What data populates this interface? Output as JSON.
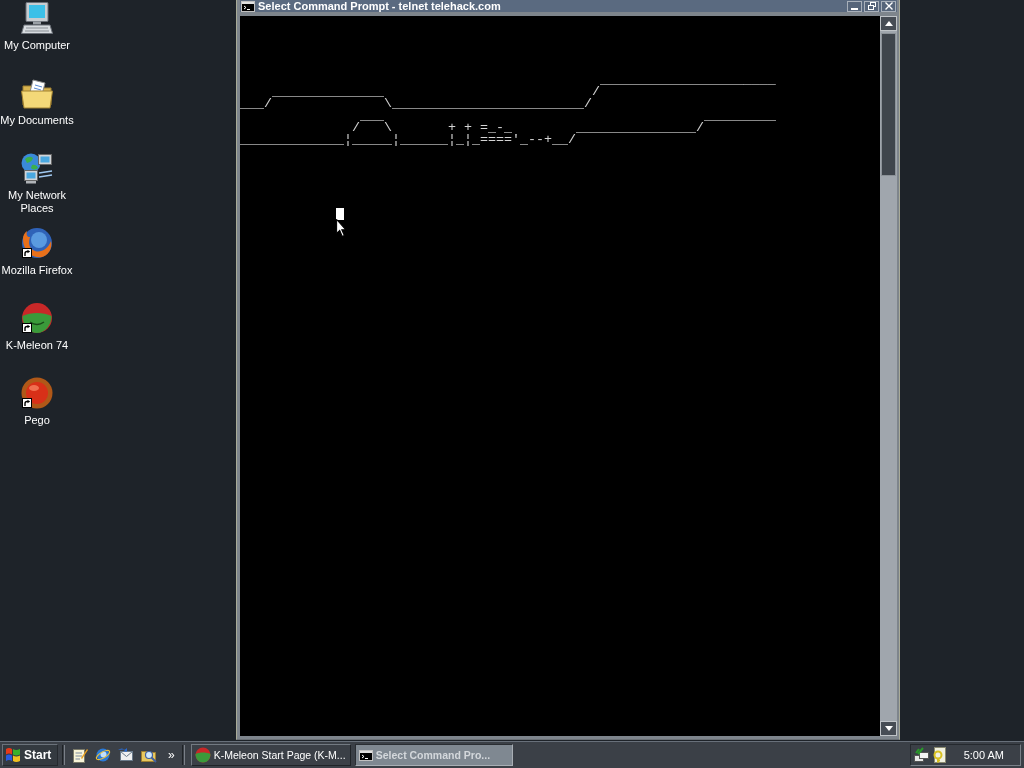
{
  "desktop_icons": [
    {
      "kind": "computer",
      "label": "My Computer",
      "shortcut": false
    },
    {
      "kind": "documents",
      "label": "My Documents",
      "shortcut": false
    },
    {
      "kind": "network",
      "label": "My Network Places",
      "shortcut": false
    },
    {
      "kind": "globe",
      "label": "Mozilla Firefox",
      "shortcut": true
    },
    {
      "kind": "melon",
      "label": "K-Meleon 74",
      "shortcut": true
    },
    {
      "kind": "orb",
      "label": "Pego",
      "shortcut": true
    }
  ],
  "window": {
    "title": "Select Command Prompt - telnet telehack.com",
    "lines": [
      "                                             ______________________",
      "    ______________                          /",
      "___/              \\________________________/",
      "               ___                                        _________",
      "              /   \\       + + =_-_        _______________/",
      "_____________¦_____¦______¦_¦_===='_--+__/"
    ]
  },
  "taskbar": {
    "start": "Start",
    "chevron": "»",
    "tasks": [
      {
        "kind": "melon",
        "label": "K-Meleon Start Page (K-M...",
        "selected": false
      },
      {
        "kind": "console",
        "label": "Select Command Pro...",
        "selected": true
      }
    ],
    "clock": "5:00 AM"
  }
}
